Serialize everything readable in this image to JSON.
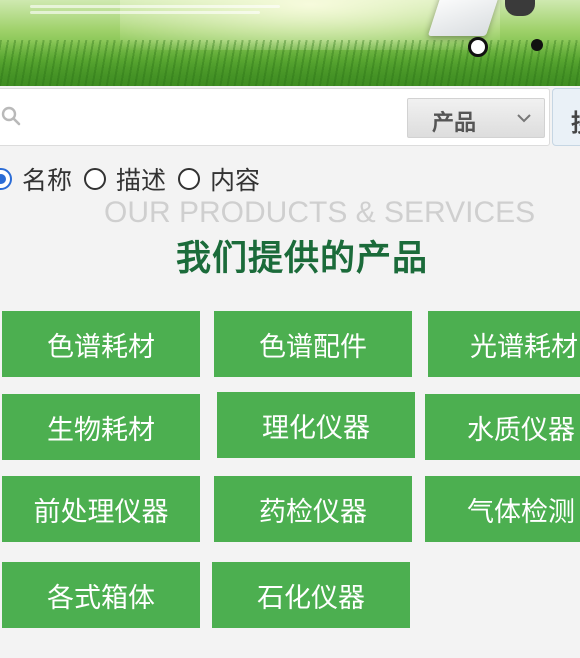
{
  "banner": {
    "slider_dots": 2,
    "active_dot": 1
  },
  "search": {
    "placeholder": "",
    "category_selected": "产品",
    "button_label": "搜索"
  },
  "radios": [
    {
      "label": "名称",
      "checked": true
    },
    {
      "label": "描述",
      "checked": false
    },
    {
      "label": "内容",
      "checked": false
    }
  ],
  "section": {
    "subtitle": "OUR PRODUCTS & SERVICES",
    "title": "我们提供的产品"
  },
  "products": [
    "色谱耗材",
    "色谱配件",
    "光谱耗材",
    "生物耗材",
    "理化仪器",
    "水质仪器",
    "前处理仪器",
    "药检仪器",
    "气体检测",
    "各式箱体",
    "石化仪器"
  ],
  "colors": {
    "tile_green": "#4caf50",
    "title_green": "#1b6b3a",
    "subtitle_gray": "#cfcfcf",
    "radio_accent": "#2b6cd6"
  }
}
